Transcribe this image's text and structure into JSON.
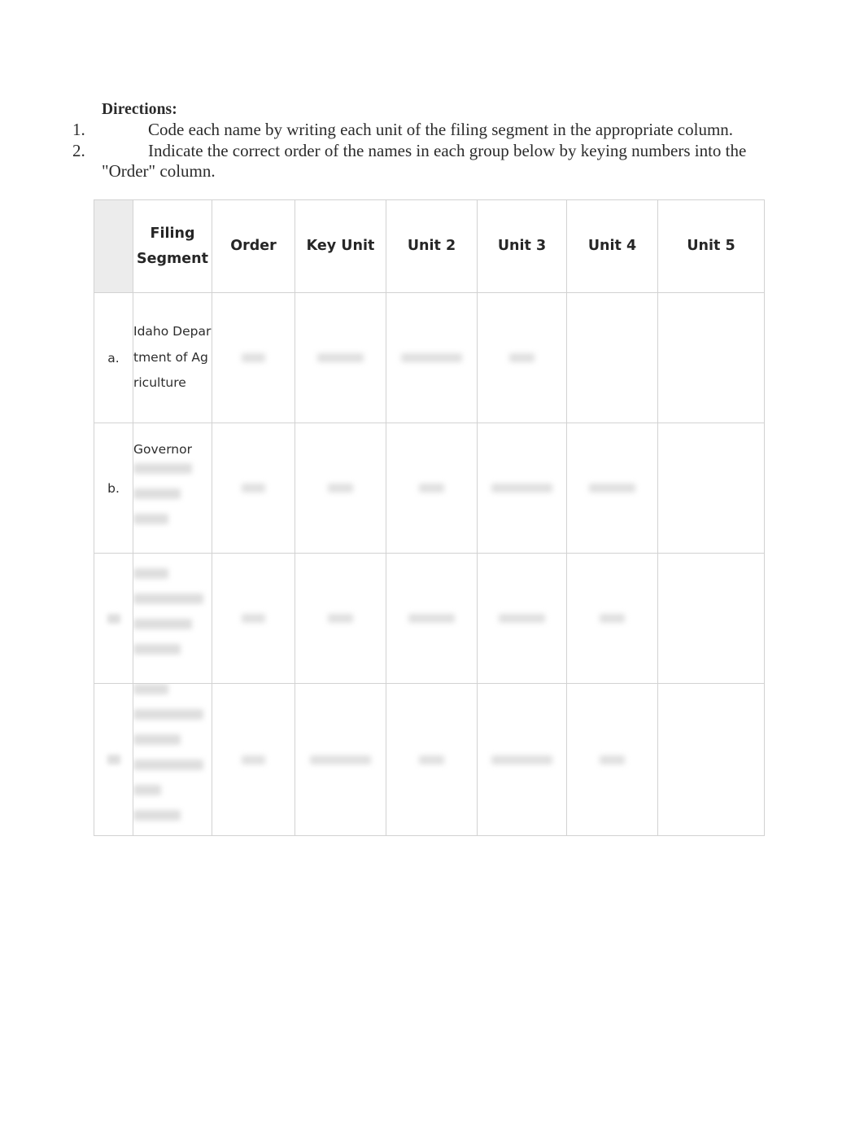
{
  "document": {
    "directions_heading": "Directions:",
    "instructions": [
      {
        "number": "1.",
        "text": "Code each name by writing each unit of the filing segment in the appropriate column."
      },
      {
        "number": "2.",
        "text": "Indicate the correct order of the names in each group below by keying numbers into the \"Order\" column."
      }
    ]
  },
  "table": {
    "headers": {
      "marker": "",
      "filing_segment": "Filing Segment",
      "order": "Order",
      "key_unit": "Key Unit",
      "unit_2": "Unit 2",
      "unit_3": "Unit 3",
      "unit_4": "Unit 4",
      "unit_5": "Unit 5"
    },
    "rows": [
      {
        "marker": "a.",
        "filing_segment": "Idaho Department of Agriculture",
        "order": "",
        "key_unit": "",
        "unit_2": "",
        "unit_3": "",
        "unit_4": "",
        "unit_5": ""
      },
      {
        "marker": "b.",
        "filing_segment": "Governor",
        "order": "",
        "key_unit": "",
        "unit_2": "",
        "unit_3": "",
        "unit_4": "",
        "unit_5": ""
      },
      {
        "marker": "",
        "filing_segment": "",
        "order": "",
        "key_unit": "",
        "unit_2": "",
        "unit_3": "",
        "unit_4": "",
        "unit_5": ""
      },
      {
        "marker": "",
        "filing_segment": "",
        "order": "",
        "key_unit": "",
        "unit_2": "",
        "unit_3": "",
        "unit_4": "",
        "unit_5": ""
      }
    ]
  },
  "colors": {
    "page_background": "#ffffff",
    "cell_shading": "#ececec",
    "border": "#d2d2d2",
    "text": "#2b2b2b"
  }
}
